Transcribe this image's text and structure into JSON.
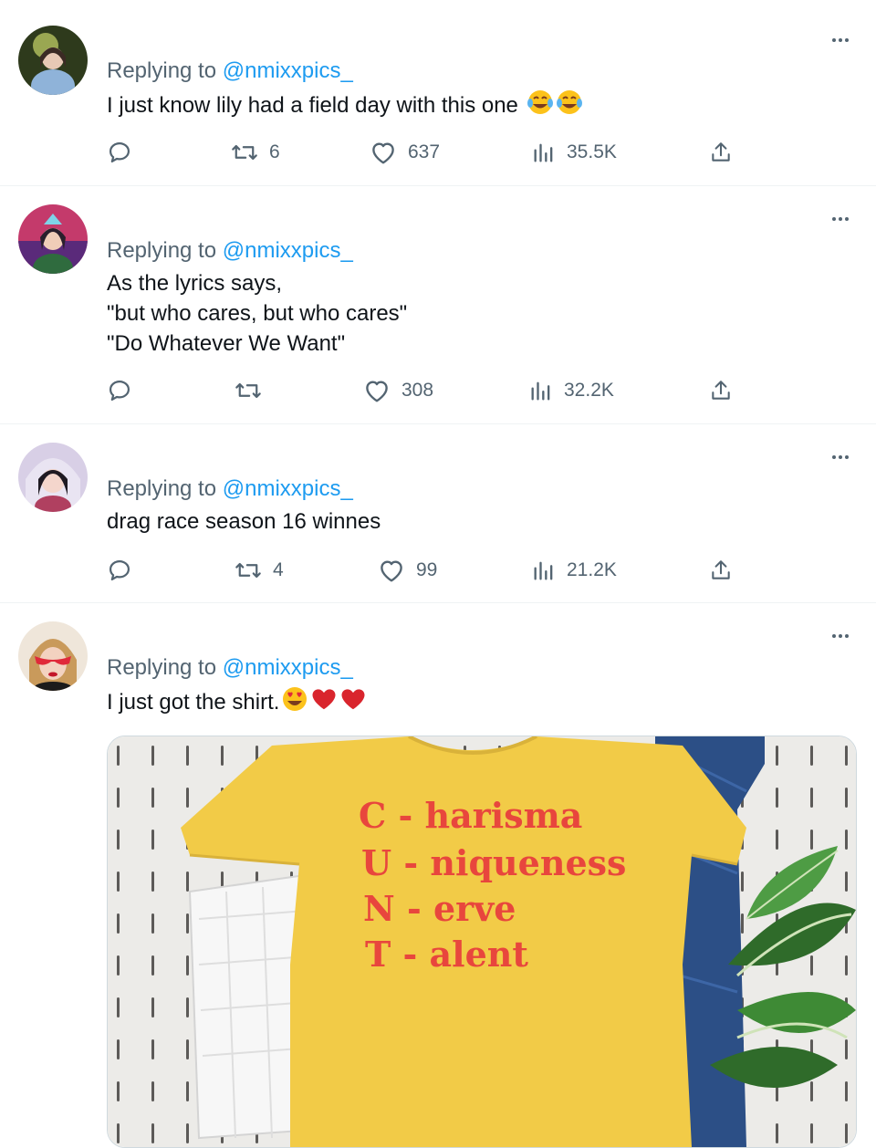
{
  "tweets": [
    {
      "reply_prefix": "Replying to",
      "reply_handle": "@nmixxpics_",
      "lines": [
        "I just know lily had a field day with this one"
      ],
      "emoji": [
        "tears-of-joy",
        "tears-of-joy"
      ],
      "stats": {
        "replies": "",
        "retweets": "6",
        "likes": "637",
        "views": "35.5K"
      }
    },
    {
      "reply_prefix": "Replying to",
      "reply_handle": "@nmixxpics_",
      "lines": [
        "As the lyrics says,",
        "\"but who cares, but who cares\"",
        "\"Do Whatever We Want\""
      ],
      "stats": {
        "replies": "",
        "retweets": "",
        "likes": "308",
        "views": "32.2K"
      }
    },
    {
      "reply_prefix": "Replying to",
      "reply_handle": "@nmixxpics_",
      "lines": [
        "drag race season 16 winnes"
      ],
      "stats": {
        "replies": "",
        "retweets": "4",
        "likes": "99",
        "views": "21.2K"
      }
    },
    {
      "reply_prefix": "Replying to",
      "reply_handle": "@nmixxpics_",
      "lines": [
        "I just got the shirt."
      ],
      "emoji": [
        "heart-eyes",
        "red-heart",
        "red-heart"
      ],
      "media": {
        "shirt_lines": [
          {
            "letter": "C",
            "rest": "harisma"
          },
          {
            "letter": "U",
            "rest": "niqueness"
          },
          {
            "letter": "N",
            "rest": "erve"
          },
          {
            "letter": "T",
            "rest": "alent"
          }
        ],
        "shirt_color": "#f2cb47",
        "print_color": "#e8463d"
      }
    }
  ],
  "colors": {
    "text": "#0f1419",
    "muted": "#536471",
    "link": "#1d9bf0",
    "divider": "#eff3f4"
  },
  "icons": [
    "more-icon",
    "reply-icon",
    "retweet-icon",
    "like-icon",
    "views-icon",
    "share-icon"
  ]
}
